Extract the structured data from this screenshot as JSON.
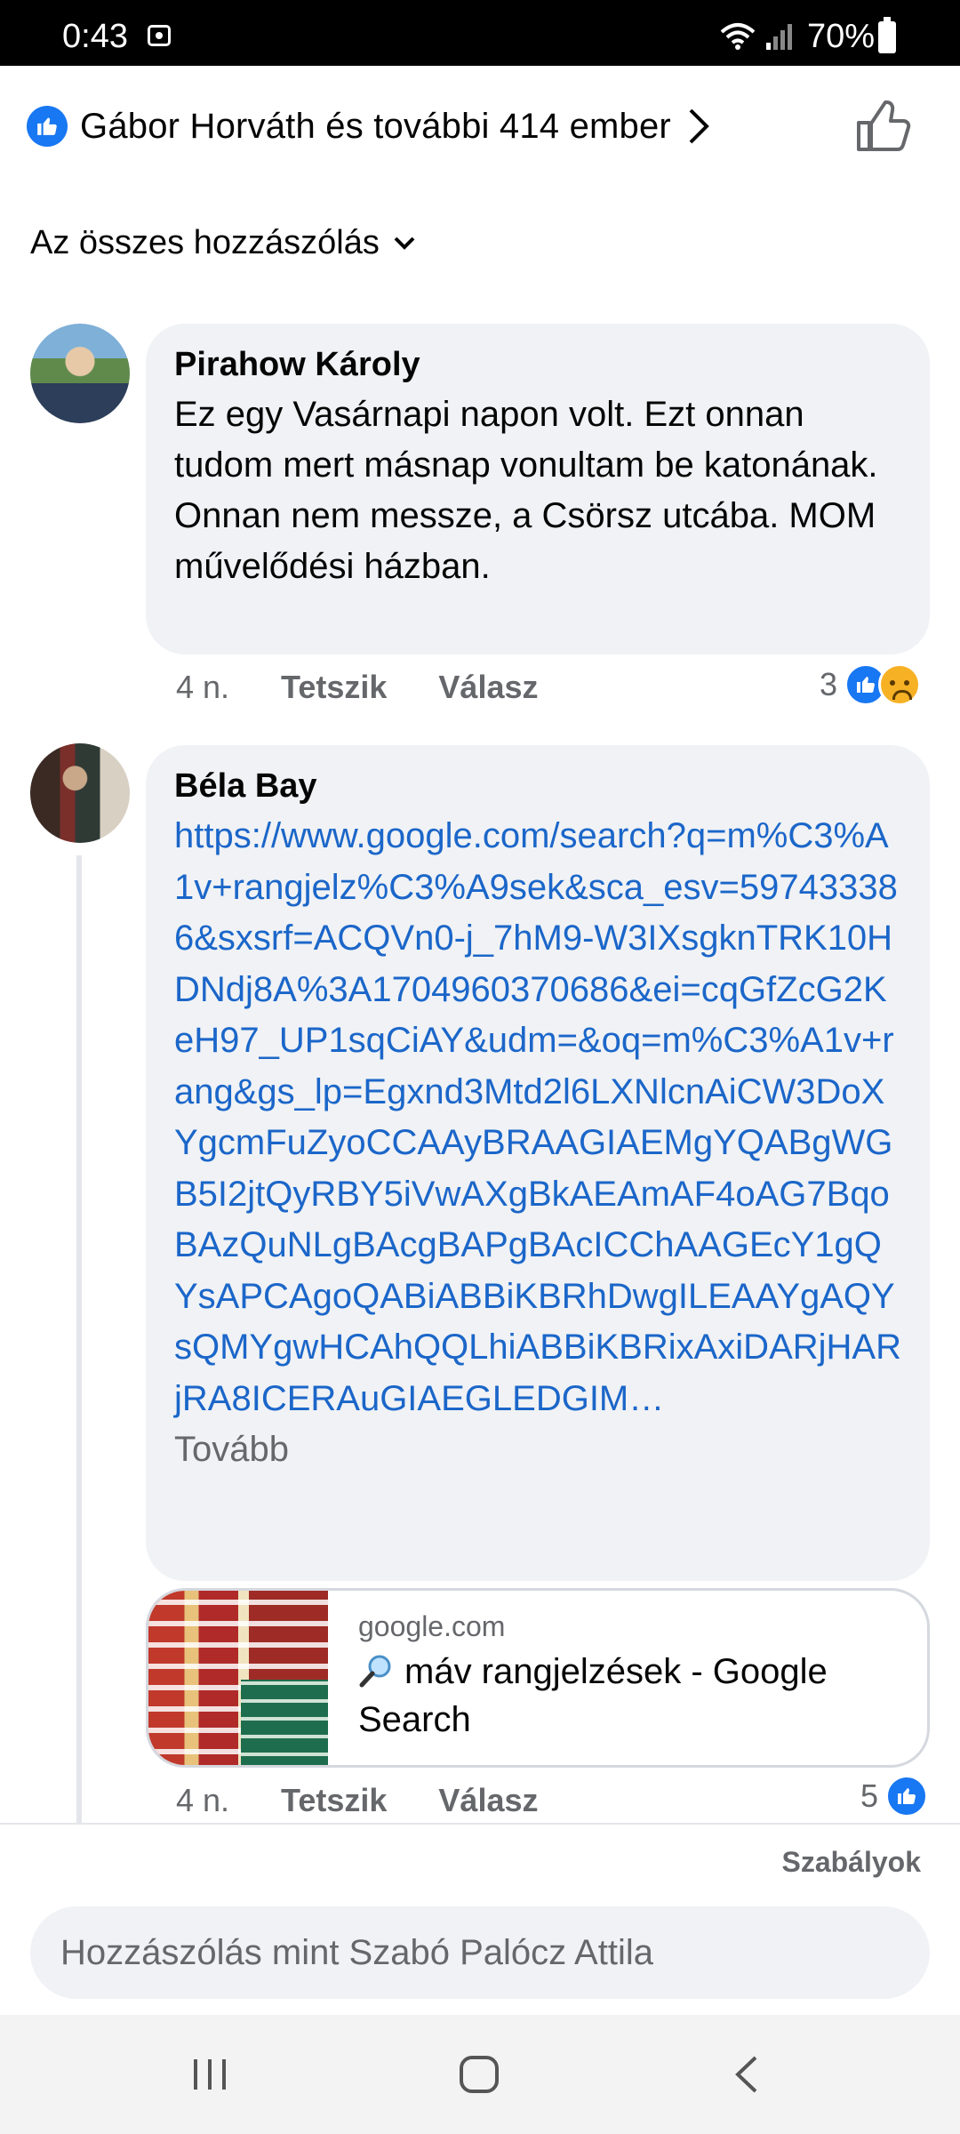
{
  "status_bar": {
    "time": "0:43",
    "battery": "70%"
  },
  "likers": {
    "text": "Gábor Horváth és további 414 ember"
  },
  "filter": {
    "label": "Az összes hozzászólás"
  },
  "comments": [
    {
      "author": "Pirahow Károly",
      "text": "Ez egy Vasárnapi napon volt. Ezt onnan tudom mert másnap vonultam be katonának. Onnan nem messze, a Csörsz utcába. MOM művelődési házban.",
      "time": "4 n.",
      "like_label": "Tetszik",
      "reply_label": "Válasz",
      "reaction_count": "3"
    },
    {
      "author": "Béla Bay",
      "link": "https://www.google.com/search?q=m%C3%A1v+rangjelz%C3%A9sek&sca_esv=597433386&sxsrf=ACQVn0-j_7hM9-W3IXsgknTRK10HDNdj8A%3A1704960370686&ei=cqGfZcG2KeH97_UP1sqCiAY&udm=&oq=m%C3%A1v+rang&gs_lp=Egxnd3Mtd2l6LXNlcnAiCW3DoXYgcmFuZyoCCAAyBRAAGIAEMgYQABgWGB5I2jtQyRBY5iVwAXgBkAEAmAF4oAG7BqoBAzQuNLgBAcgBAPgBAcICChAAGEcY1gQYsAPCAgoQABiABBiKBRhDwgILEAAYgAQYsQMYgwHCAhQQLhiABBiKBRixAxiDARjHARjRA8ICERAuGIAEGLEDGIM…",
      "more_label": "Tovább",
      "preview": {
        "domain": "google.com",
        "title": "máv rangjelzések - Google Search"
      },
      "time": "4 n.",
      "like_label": "Tetszik",
      "reply_label": "Válasz",
      "reaction_count": "5"
    }
  ],
  "footer": {
    "rules_label": "Szabályok",
    "compose_placeholder": "Hozzászólás mint Szabó Palócz Attila"
  },
  "colors": {
    "accent": "#1877f2",
    "link": "#1b66c9",
    "bubble": "#f0f2f5",
    "muted": "#65676b"
  }
}
